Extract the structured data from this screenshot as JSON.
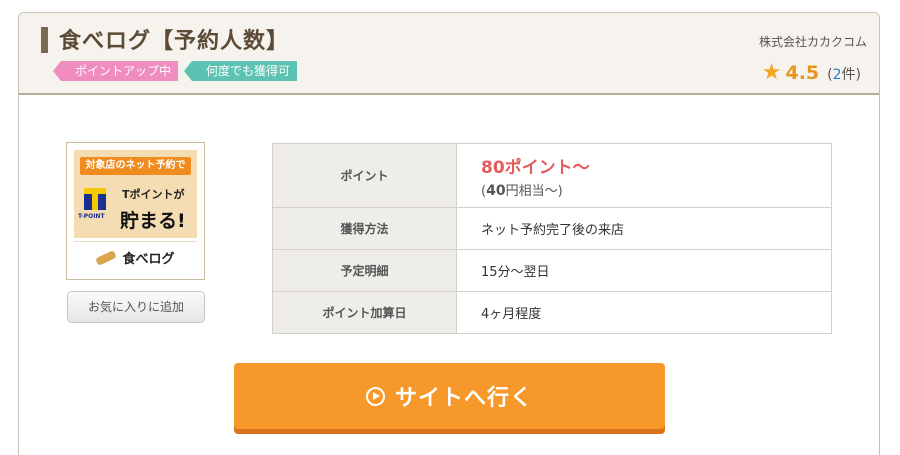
{
  "header": {
    "title": "食べログ【予約人数】",
    "tags": [
      "ポイントアップ中",
      "何度でも獲得可"
    ],
    "company": "株式会社カカクコム",
    "rating": {
      "score": "4.5",
      "count_prefix": "(",
      "count_num": "2",
      "count_suffix": "件)"
    }
  },
  "logo": {
    "banner": "対象店のネット予約で",
    "tpoint_label": "T-POINT",
    "tpoint_line1": "Tポイントが",
    "tpoint_line2": "貯まる!",
    "brand": "食べログ"
  },
  "favorite_button": "お気に入りに追加",
  "info_table": {
    "rows": [
      {
        "label": "ポイント",
        "value": "80ポイント〜",
        "sub_prefix": "(",
        "sub_num": "40",
        "sub_suffix": "円相当〜)"
      },
      {
        "label": "獲得方法",
        "value": "ネット予約完了後の来店"
      },
      {
        "label": "予定明細",
        "value": "15分〜翌日"
      },
      {
        "label": "ポイント加算日",
        "value": "4ヶ月程度"
      }
    ]
  },
  "cta": {
    "label": "サイトへ行く"
  },
  "colors": {
    "accent": "#f6992a",
    "point_red": "#e45b5b",
    "star": "#f3a622",
    "tag_pink": "#ef8dbf",
    "tag_teal": "#5cc2b1"
  },
  "icons": [
    "star-icon",
    "play-circle-icon",
    "tpoint-logo-icon",
    "tabelog-logo-icon"
  ]
}
